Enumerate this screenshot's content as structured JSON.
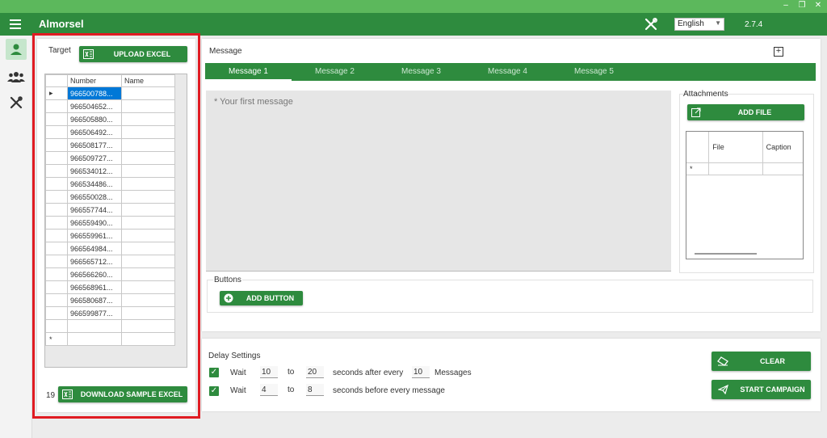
{
  "window": {
    "minimize": "–",
    "maximize": "❐",
    "close": "✕"
  },
  "header": {
    "title": "Almorsel",
    "language": "English",
    "version": "2.7.4"
  },
  "sidebar": {
    "items": [
      "user-icon",
      "group-icon",
      "tools-icon"
    ]
  },
  "target": {
    "label": "Target",
    "upload_button": "UPLOAD EXCEL",
    "columns": [
      "Number",
      "Name"
    ],
    "numbers": [
      "966500788...",
      "966504652...",
      "966505880...",
      "966506492...",
      "966508177...",
      "966509727...",
      "966534012...",
      "966534486...",
      "966550028...",
      "966557744...",
      "966559490...",
      "966559961...",
      "966564984...",
      "966565712...",
      "966566260...",
      "966568961...",
      "966580687...",
      "966599877..."
    ],
    "new_row_marker": "*",
    "current_row_marker": "▸",
    "count": "19",
    "download_button": "DOWNLOAD SAMPLE EXCEL"
  },
  "message": {
    "label": "Message",
    "add_tab": "+",
    "tabs": [
      "Message 1",
      "Message 2",
      "Message 3",
      "Message 4",
      "Message 5"
    ],
    "active_tab": 0,
    "placeholder": "* Your first message",
    "attachments_label": "Attachments",
    "add_file_button": "ADD FILE",
    "attachment_columns": [
      "File",
      "Caption"
    ],
    "attachment_new_row": "*",
    "buttons_label": "Buttons",
    "add_button": "ADD BUTTON"
  },
  "delay": {
    "label": "Delay Settings",
    "row1": {
      "wait": "Wait",
      "from": "10",
      "to": "to",
      "to_value": "20",
      "after": "seconds after every",
      "count": "10",
      "unit": "Messages"
    },
    "row2": {
      "wait": "Wait",
      "from": "4",
      "to": "to",
      "to_value": "8",
      "before": "seconds before every message"
    },
    "clear_button": "CLEAR",
    "start_button": "START CAMPAIGN"
  },
  "colors": {
    "brand": "#2e8b3e",
    "titlebar": "#5cb85c",
    "selection": "#0078d7",
    "highlight": "#e01b22"
  }
}
